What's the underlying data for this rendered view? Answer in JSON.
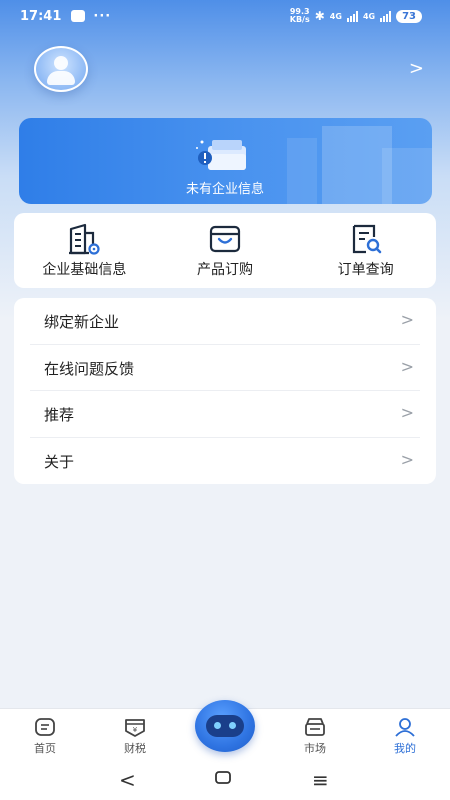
{
  "status_bar": {
    "time": "17:41",
    "dots": "···",
    "net_speed_value": "99.3",
    "net_speed_unit": "KB/s",
    "network_1": "4G",
    "network_2": "4G",
    "battery": "73"
  },
  "profile": {
    "avatar": "avatar-placeholder"
  },
  "banner": {
    "text": "未有企业信息"
  },
  "quick_actions": [
    {
      "label": "企业基础信息",
      "icon": "enterprise-info-icon"
    },
    {
      "label": "产品订购",
      "icon": "product-order-icon"
    },
    {
      "label": "订单查询",
      "icon": "order-search-icon"
    }
  ],
  "menu": [
    {
      "label": "绑定新企业"
    },
    {
      "label": "在线问题反馈"
    },
    {
      "label": "推荐"
    },
    {
      "label": "关于"
    }
  ],
  "tabbar": [
    {
      "label": "首页",
      "icon": "home-icon"
    },
    {
      "label": "财税",
      "icon": "tax-icon"
    },
    {
      "label": "",
      "icon": "robot-assistant-icon"
    },
    {
      "label": "市场",
      "icon": "market-icon"
    },
    {
      "label": "我的",
      "icon": "user-icon",
      "active": true
    }
  ],
  "nav": {
    "back": "<",
    "home": "○",
    "menu": "≡"
  },
  "colors": {
    "accent": "#2d6fd6",
    "banner": "#3a86ec",
    "background": "#eef2f8"
  }
}
